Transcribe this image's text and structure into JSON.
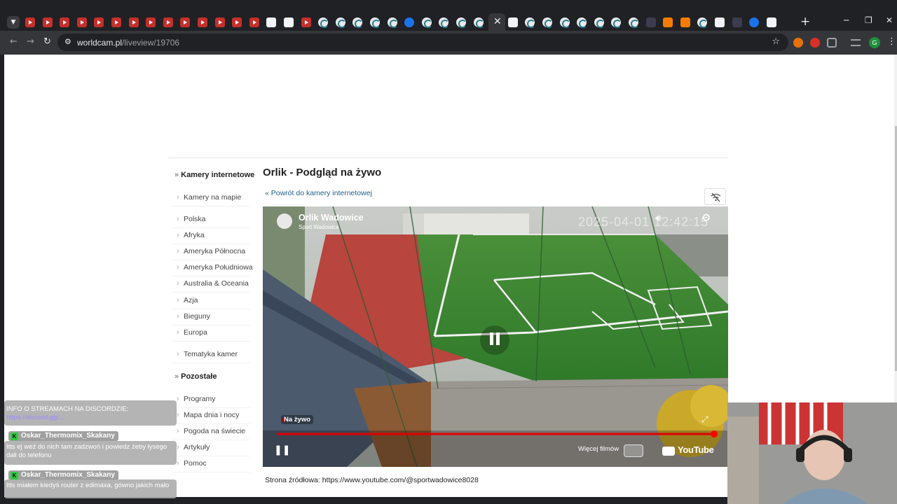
{
  "browser": {
    "url_host": "worldcam.pl",
    "url_path": "/liveview/19706",
    "profile_initial": "G"
  },
  "sidebar": {
    "header_cameras": "Kamery internetowe",
    "group1": [
      "Kamery na mapie"
    ],
    "regions": [
      "Polska",
      "Afryka",
      "Ameryka Północna",
      "Ameryka Południowa",
      "Australia & Oceania",
      "Azja",
      "Bieguny",
      "Europa"
    ],
    "group3": [
      "Tematyka kamer"
    ],
    "header_other": "Pozostałe",
    "other": [
      "Programy",
      "Mapa dnia i nocy",
      "Pogoda na świecie",
      "Artykuły",
      "Pomoc"
    ]
  },
  "main": {
    "title": "Orlik - Podgląd na żywo",
    "back_link": "« Powrót do kamery internetowej",
    "source": "Strona źródłowa: https://www.youtube.com/@sportwadowice8028"
  },
  "player": {
    "channel_name": "Orlik Wadowice",
    "channel_sub": "Sport Wadowice",
    "timestamp": "2025-04-01 12:42:15",
    "live_label": "Na żywo",
    "more_videos": "Więcej filmów",
    "youtube": "YouTube",
    "progress_fraction": 1.0
  },
  "overlay": {
    "info": "INFO O STREAMACH NA DISCORDZIE:",
    "link": "https://discord.gg/...",
    "messages": [
      {
        "user": "Oskar_Thermomix_Skakany",
        "text": "Itts ej weź do nich tam zadzwoń i powiedz żeby łysego dali do telefonu"
      },
      {
        "user": "Oskar_Thermomix_Skakany",
        "text": "Itts miałem kiedyś router z edimaxa, gówno jakich mało"
      }
    ]
  }
}
